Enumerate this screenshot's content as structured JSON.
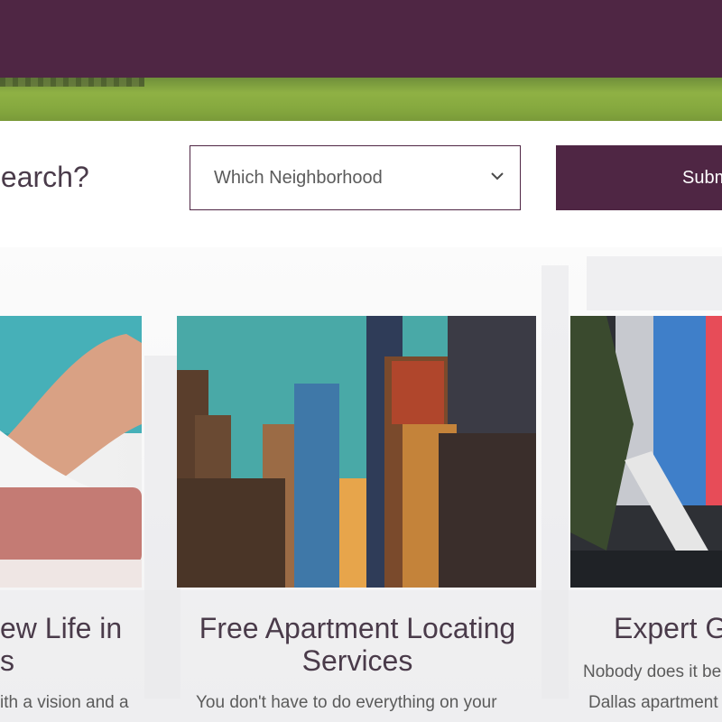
{
  "search": {
    "question_fragment": "r Search?",
    "neighborhood_select_value": "Which Neighborhood",
    "submit_label": "Submit"
  },
  "cards": [
    {
      "title_line1": "ew Life in",
      "title_line2": "s",
      "text": "ith a vision and a"
    },
    {
      "title_line1": "Free Apartment Locating",
      "title_line2": "Services",
      "text": "You don't have to do everything on your"
    },
    {
      "title_line1": "Expert G",
      "text_line1": "Nobody does it be",
      "text_line2": "Dallas apartment"
    }
  ],
  "colors": {
    "brand": "#4f2644",
    "text": "#4a3b4a",
    "muted": "#5b5b5b"
  },
  "icons": {
    "select_chevron": "chevron-down-icon"
  }
}
